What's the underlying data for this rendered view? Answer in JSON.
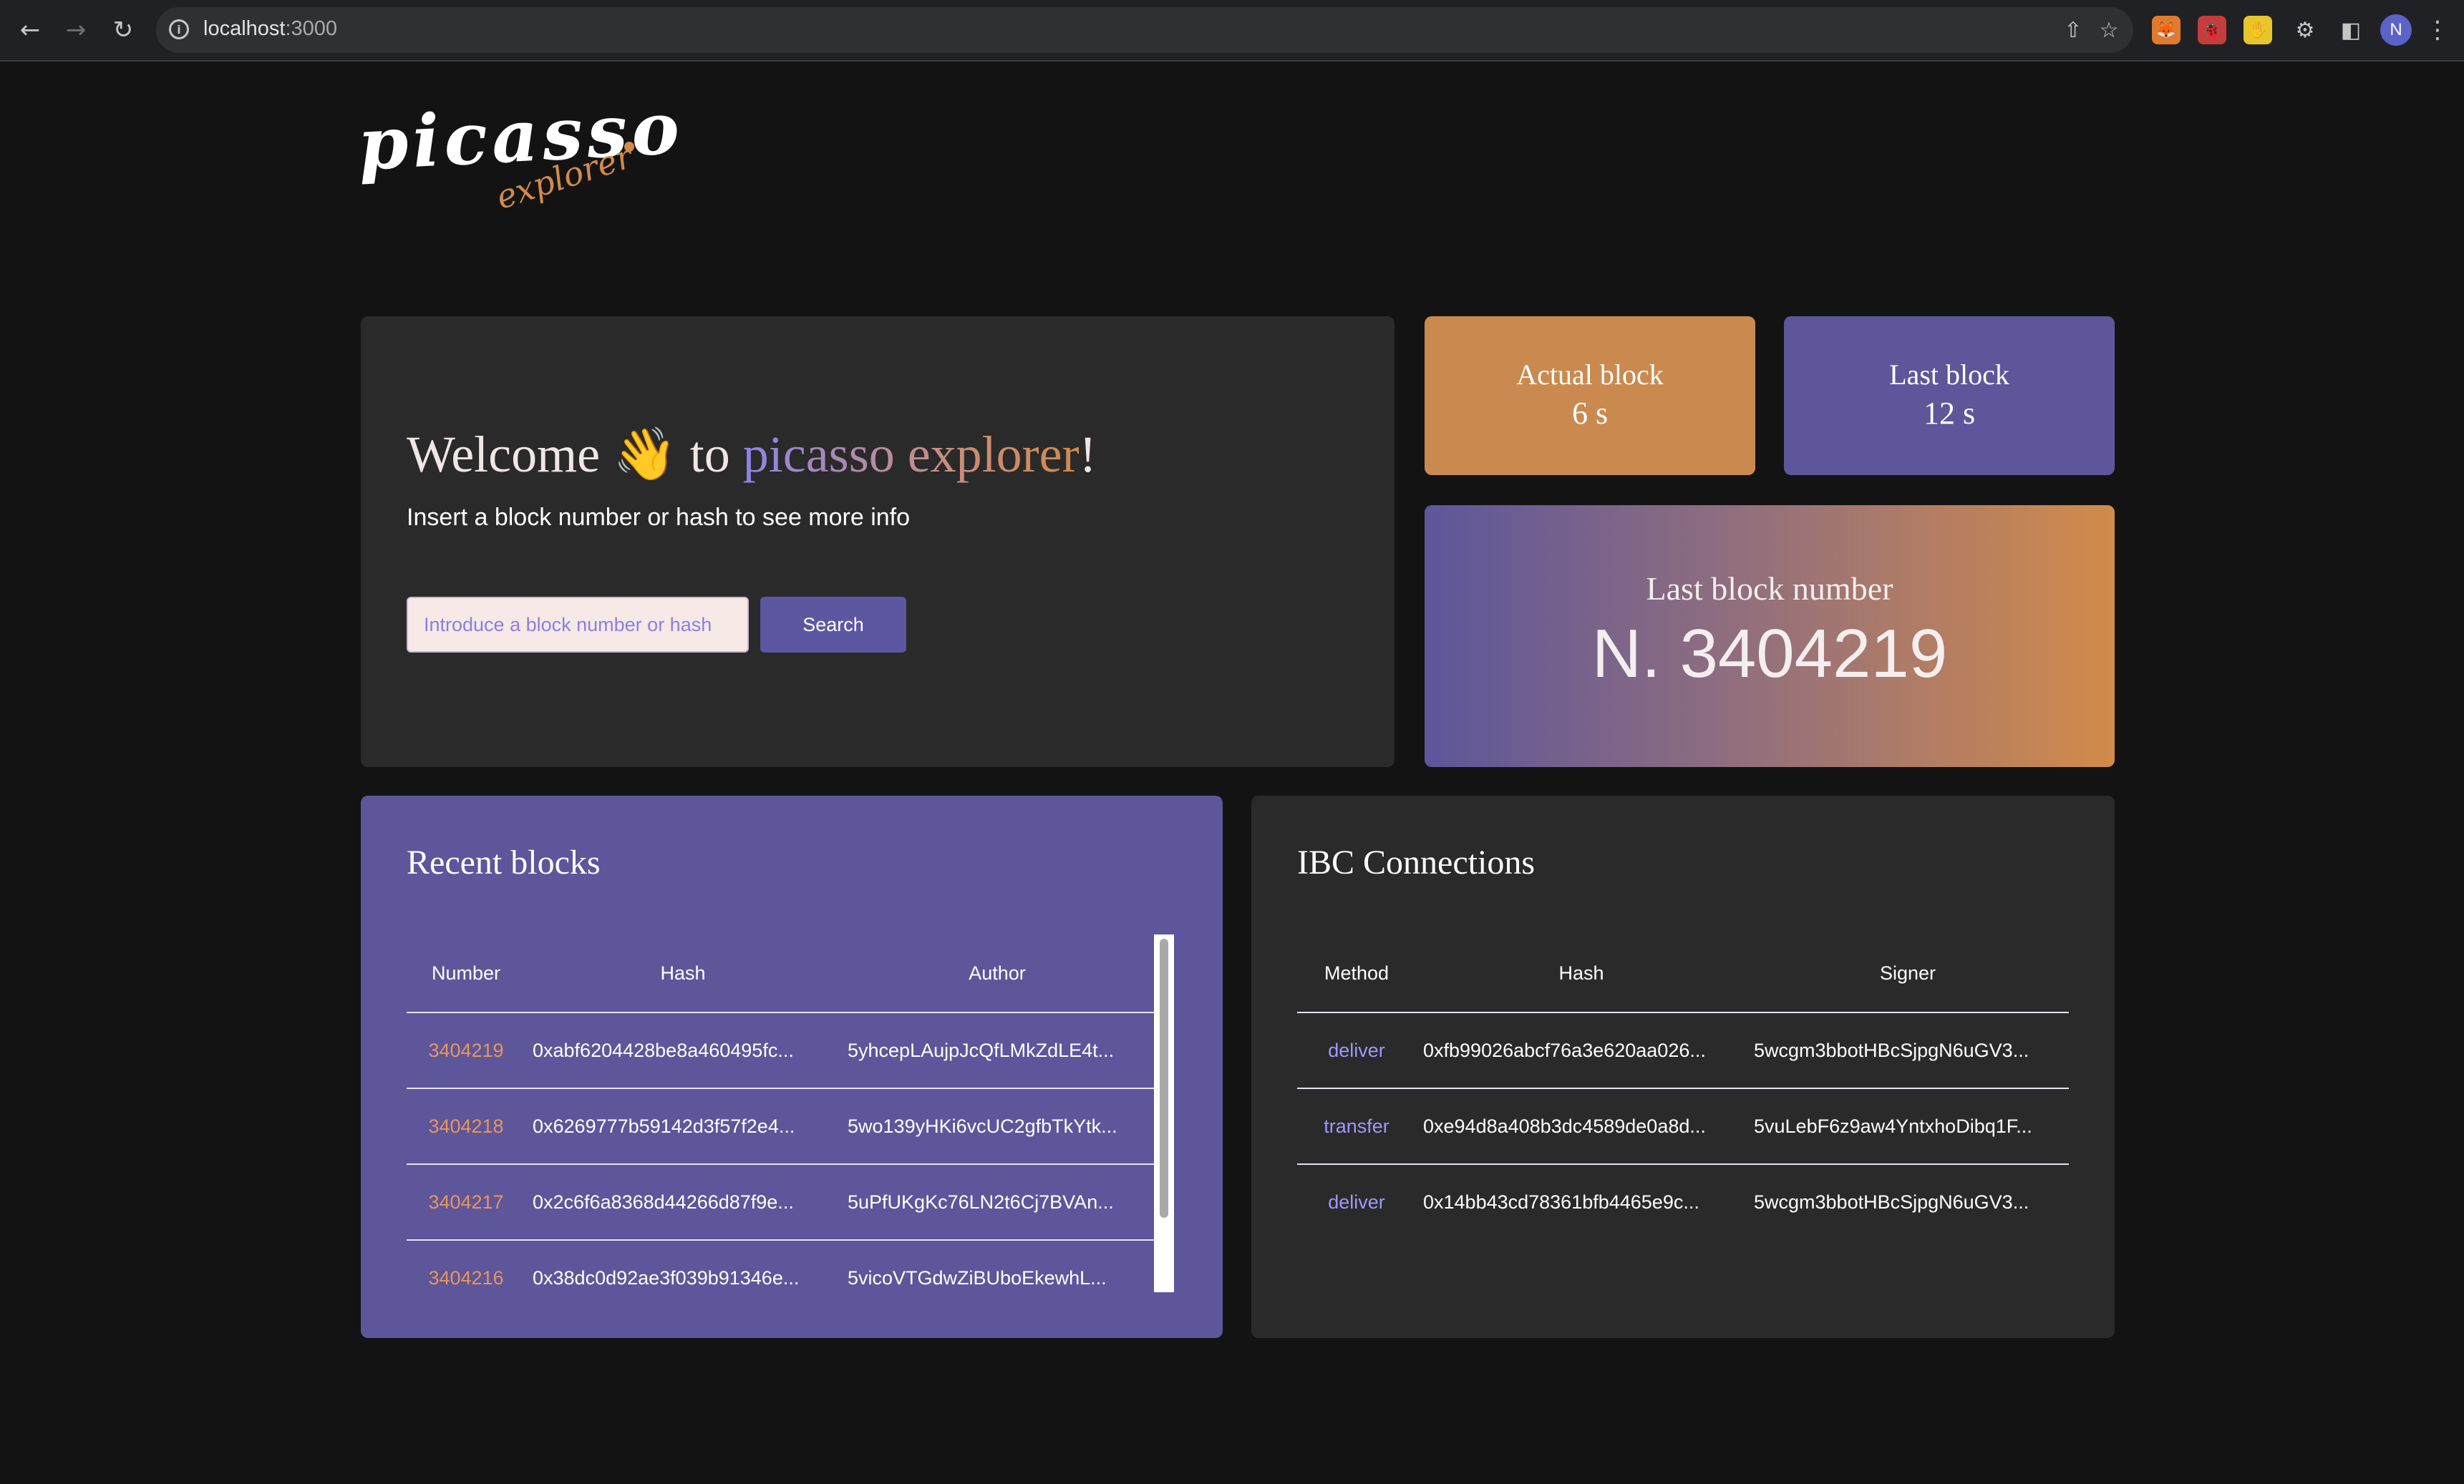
{
  "browser": {
    "url_host": "localhost",
    "url_port": ":3000",
    "profile_initial": "N"
  },
  "logo": {
    "main": "picasso",
    "sub": "explorer"
  },
  "welcome": {
    "title_prefix": "Welcome",
    "emoji": "👋",
    "title_mid": "to",
    "title_accent": "picasso explorer",
    "title_suffix": "!",
    "subtitle": "Insert a block number or hash to see more info",
    "search_placeholder": "Introduce a block number or hash",
    "search_label": "Search"
  },
  "stats": {
    "actual_block": {
      "label": "Actual block",
      "value": "6 s"
    },
    "last_block": {
      "label": "Last block",
      "value": "12 s"
    },
    "last_block_number": {
      "label": "Last block number",
      "value": "N. 3404219"
    }
  },
  "recent_blocks": {
    "title": "Recent blocks",
    "columns": [
      "Number",
      "Hash",
      "Author"
    ],
    "rows": [
      {
        "number": "3404219",
        "hash": "0xabf6204428be8a460495fc...",
        "author": "5yhcepLAujpJcQfLMkZdLE4t..."
      },
      {
        "number": "3404218",
        "hash": "0x6269777b59142d3f57f2e4...",
        "author": "5wo139yHKi6vcUC2gfbTkYtk..."
      },
      {
        "number": "3404217",
        "hash": "0x2c6f6a8368d44266d87f9e...",
        "author": "5uPfUKgKc76LN2t6Cj7BVAn..."
      },
      {
        "number": "3404216",
        "hash": "0x38dc0d92ae3f039b91346e...",
        "author": "5vicoVTGdwZiBUboEkewhL..."
      }
    ]
  },
  "ibc_connections": {
    "title": "IBC Connections",
    "columns": [
      "Method",
      "Hash",
      "Signer"
    ],
    "rows": [
      {
        "method": "deliver",
        "hash": "0xfb99026abcf76a3e620aa026...",
        "signer": "5wcgm3bbotHBcSjpgN6uGV3..."
      },
      {
        "method": "transfer",
        "hash": "0xe94d8a408b3dc4589de0a8d...",
        "signer": "5vuLebF6z9aw4YntxhoDibq1F..."
      },
      {
        "method": "deliver",
        "hash": "0x14bb43cd78361bfb4465e9c...",
        "signer": "5wcgm3bbotHBcSjpgN6uGV3..."
      }
    ]
  }
}
